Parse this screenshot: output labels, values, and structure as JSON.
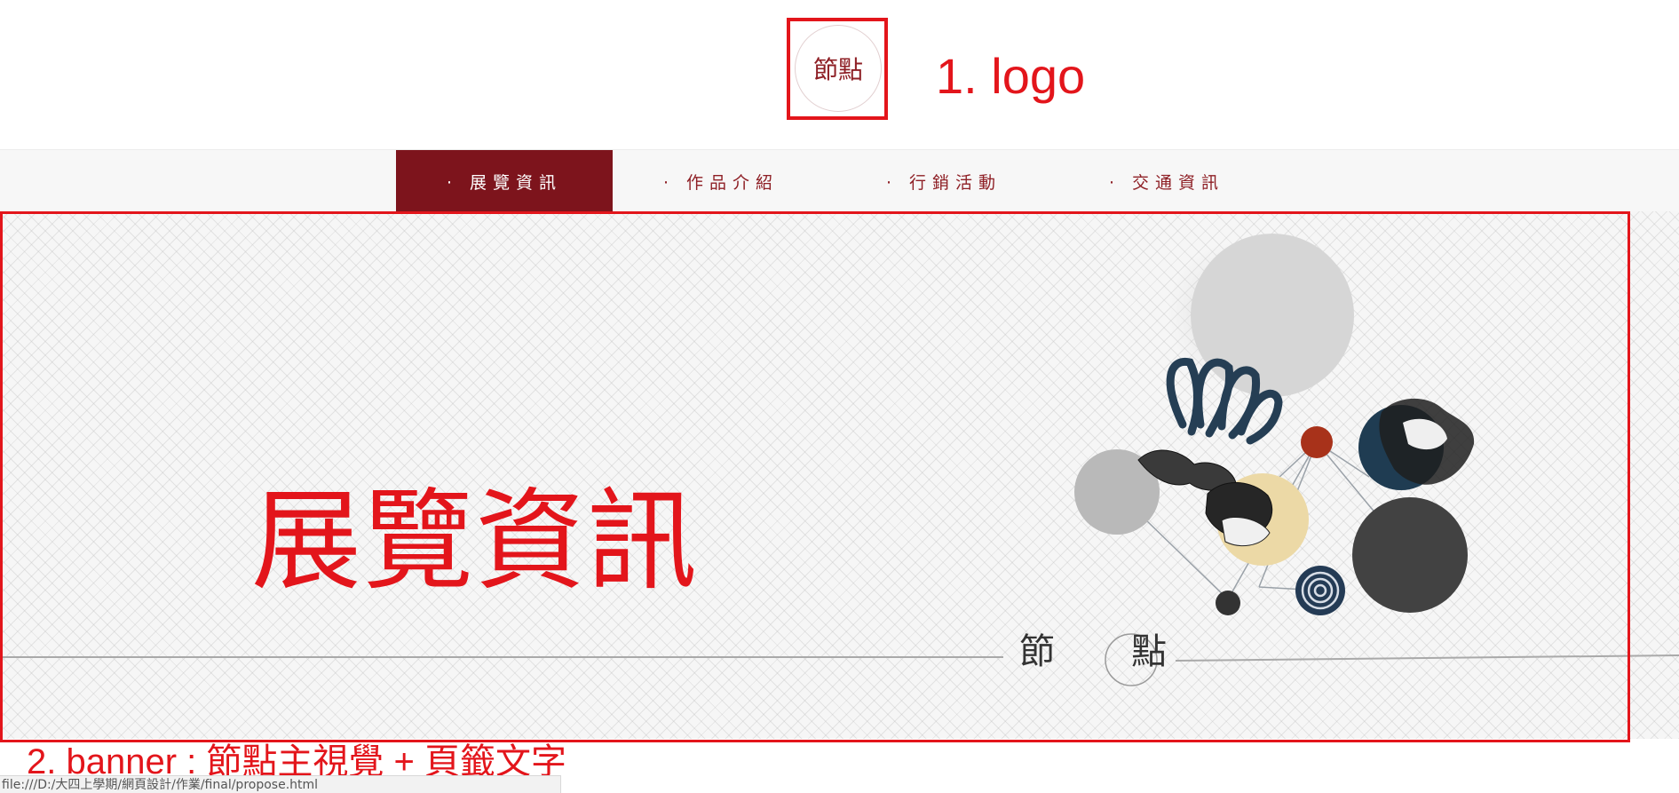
{
  "logo": {
    "text": "節點",
    "annotation": "1. logo"
  },
  "nav": {
    "items": [
      {
        "label": "· 展覽資訊",
        "active": true
      },
      {
        "label": "· 作品介紹",
        "active": false
      },
      {
        "label": "· 行銷活動",
        "active": false
      },
      {
        "label": "· 交通資訊",
        "active": false
      }
    ]
  },
  "banner": {
    "title": "展覽資訊",
    "signature_left": "節",
    "signature_right": "點",
    "annotation": "2. banner : 節點主視覺 + 頁籤文字"
  },
  "status_bar": {
    "url": "file:///D:/大四上學期/網頁設計/作業/final/propose.html"
  },
  "colors": {
    "accent": "#7d141c",
    "annotation_red": "#e3151b",
    "nav_text": "#8e1f25"
  }
}
